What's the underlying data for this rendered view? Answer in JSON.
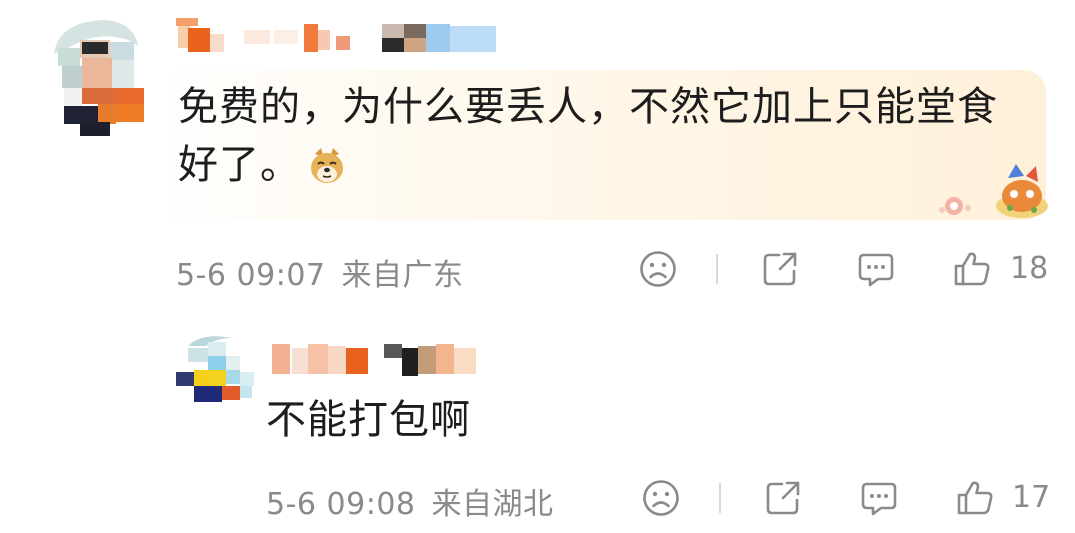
{
  "comments": [
    {
      "text": "免费的，为什么要丢人，不然它加上只能堂食好了。",
      "emoji": "doge-emoji",
      "time": "5-6 09:07",
      "location": "来自广东",
      "likes": "18"
    },
    {
      "text": "不能打包啊",
      "time": "5-6 09:08",
      "location": "来自湖北",
      "likes": "17"
    }
  ],
  "icons": {
    "sad": "sad-face-icon",
    "share": "share-icon",
    "comment": "comment-icon",
    "like": "thumbs-up-icon"
  },
  "colors": {
    "meta_text": "#8a8a8a",
    "bubble_accent": "#fff0d9"
  }
}
